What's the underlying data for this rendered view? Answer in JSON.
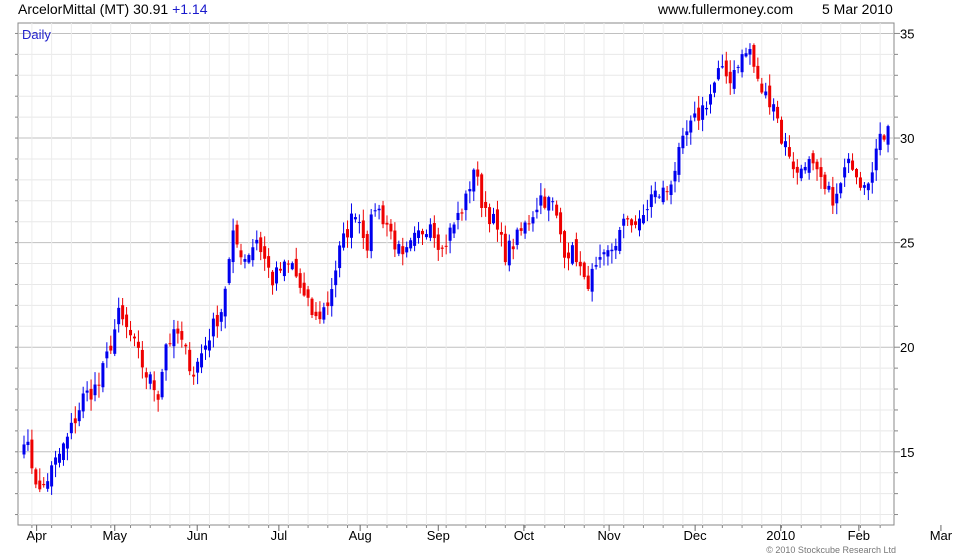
{
  "header": {
    "ticker": "ArcelorMittal (MT)",
    "last": "30.91",
    "change": "+1.14",
    "site": "www.fullermoney.com",
    "date": "5 Mar 2010"
  },
  "footer": {
    "copyright": "© 2010 Stockcube Research Ltd"
  },
  "chart_data": {
    "type": "candlestick",
    "interval_label": "Daily",
    "y_range": [
      11.5,
      35.5
    ],
    "y_ticks": [
      15,
      20,
      25,
      30,
      35
    ],
    "x_labels": [
      "Apr",
      "May",
      "Jun",
      "Jul",
      "Aug",
      "Sep",
      "Oct",
      "Nov",
      "Dec",
      "2010",
      "Feb",
      "Mar"
    ],
    "grid": true,
    "colors": {
      "up": "#0000ee",
      "down": "#ee0000",
      "grid": "#d8d8d8",
      "interval_label": "#2222cc"
    },
    "x_label_positions": [
      3.2,
      23.0,
      43.9,
      64.6,
      85.2,
      105.0,
      126.7,
      148.3,
      170.1,
      191.8,
      211.6,
      232.4
    ],
    "anchors": [
      [
        0,
        15.8
      ],
      [
        4,
        13.0
      ],
      [
        8,
        14.5
      ],
      [
        11,
        15.6
      ],
      [
        15,
        17.6
      ],
      [
        19,
        18.2
      ],
      [
        24,
        21.5
      ],
      [
        27,
        20.5
      ],
      [
        31,
        18.7
      ],
      [
        34,
        17.8
      ],
      [
        36,
        20.2
      ],
      [
        39,
        20.6
      ],
      [
        43,
        18.8
      ],
      [
        47,
        20.6
      ],
      [
        50,
        21.8
      ],
      [
        53,
        25.2
      ],
      [
        56,
        24.3
      ],
      [
        59,
        25.2
      ],
      [
        63,
        23.2
      ],
      [
        65,
        23.7
      ],
      [
        68,
        23.9
      ],
      [
        71,
        22.3
      ],
      [
        74,
        21.3
      ],
      [
        77,
        22.1
      ],
      [
        80,
        24.6
      ],
      [
        84,
        26.6
      ],
      [
        87,
        25.0
      ],
      [
        89,
        26.8
      ],
      [
        92,
        25.9
      ],
      [
        96,
        24.1
      ],
      [
        99,
        25.1
      ],
      [
        103,
        26.1
      ],
      [
        106,
        24.6
      ],
      [
        108,
        25.5
      ],
      [
        112,
        27.0
      ],
      [
        114,
        28.6
      ],
      [
        116,
        27.0
      ],
      [
        119,
        26.0
      ],
      [
        122,
        24.5
      ],
      [
        125,
        25.2
      ],
      [
        128,
        26.1
      ],
      [
        131,
        27.2
      ],
      [
        134,
        26.8
      ],
      [
        137,
        24.7
      ],
      [
        140,
        24.4
      ],
      [
        142,
        23.0
      ],
      [
        145,
        23.6
      ],
      [
        148,
        24.4
      ],
      [
        151,
        25.4
      ],
      [
        153,
        26.2
      ],
      [
        156,
        25.8
      ],
      [
        159,
        27.2
      ],
      [
        163,
        27.5
      ],
      [
        165,
        28.6
      ],
      [
        168,
        30.2
      ],
      [
        171,
        31.1
      ],
      [
        174,
        32.1
      ],
      [
        176,
        33.1
      ],
      [
        179,
        32.9
      ],
      [
        181,
        33.7
      ],
      [
        184,
        34.2
      ],
      [
        186,
        32.6
      ],
      [
        188,
        32.0
      ],
      [
        190,
        31.8
      ],
      [
        192,
        30.0
      ],
      [
        194,
        29.3
      ],
      [
        196,
        28.2
      ],
      [
        198,
        29.0
      ],
      [
        200,
        28.5
      ],
      [
        203,
        27.4
      ],
      [
        206,
        27.1
      ],
      [
        208,
        28.4
      ],
      [
        210,
        28.9
      ],
      [
        212,
        28.0
      ],
      [
        214,
        28.2
      ],
      [
        216,
        29.4
      ],
      [
        218,
        30.2
      ],
      [
        219,
        30.9
      ]
    ]
  }
}
